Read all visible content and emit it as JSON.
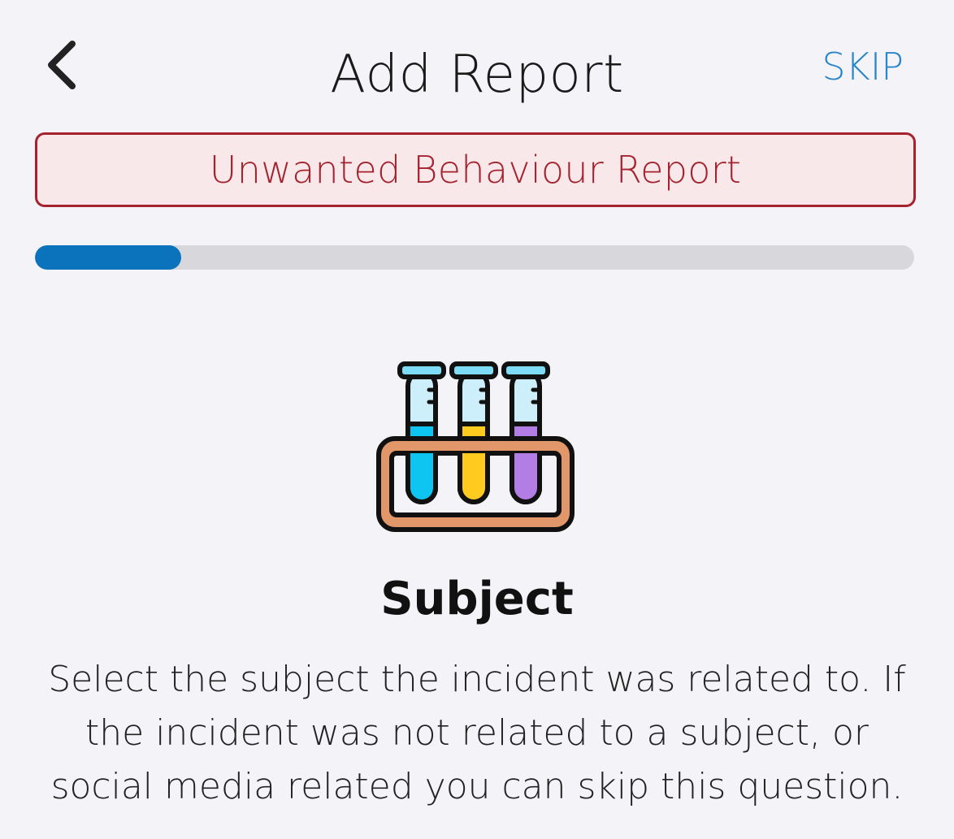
{
  "header": {
    "title": "Add Report",
    "skip_label": "SKIP",
    "back_icon": "chevron-left-icon"
  },
  "banner": {
    "label": "Unwanted Behaviour Report",
    "border_color": "#a5232f",
    "background_color": "#f8e8ea"
  },
  "progress": {
    "fraction": 0.166,
    "fill_color": "#0b73bc",
    "track_color": "#d8d8dc"
  },
  "question": {
    "icon": "test-tubes-icon",
    "title": "Subject",
    "description": "Select the subject the incident was related to. If the incident was not related to a subject, or social media related you can skip this question."
  },
  "colors": {
    "accent": "#2a85c9",
    "background": "#f4f4f8"
  }
}
